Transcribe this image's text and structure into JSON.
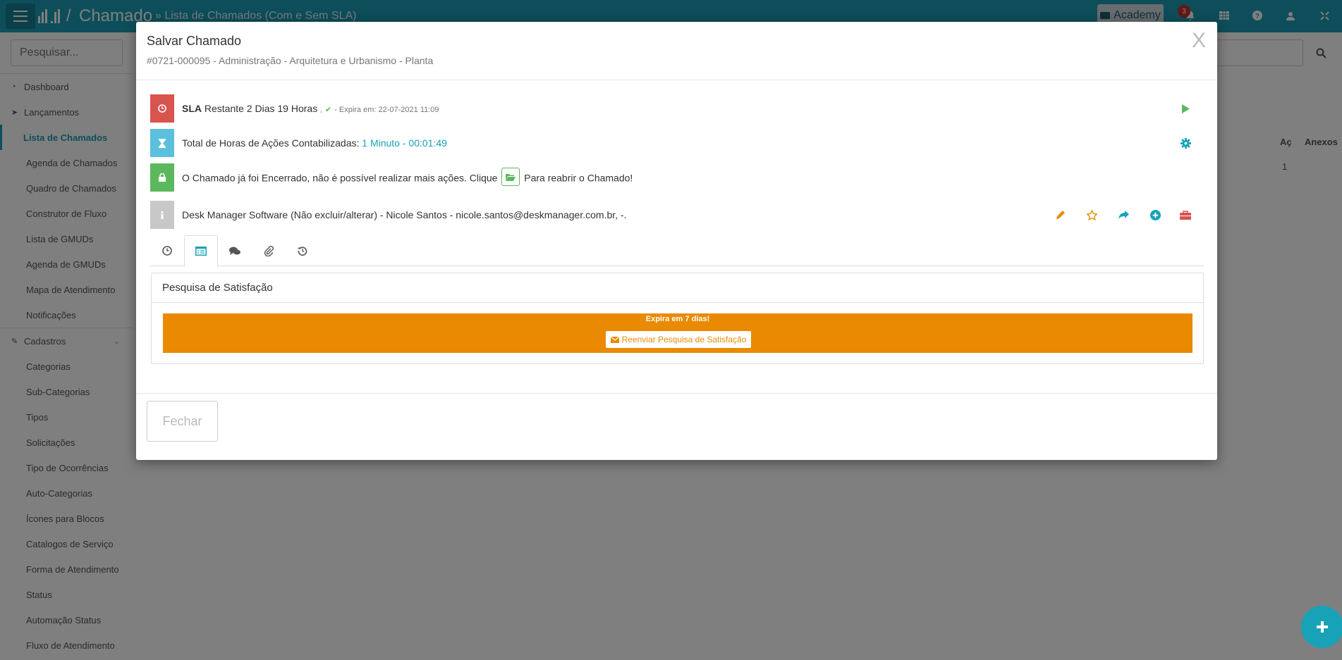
{
  "topbar": {
    "app_title": "Chamado",
    "breadcrumb": "» Lista de Chamados (Com e Sem SLA)",
    "academy_label": "Academy",
    "notification_count": "3"
  },
  "sidebar": {
    "search_placeholder": "Pesquisar...",
    "items": [
      {
        "label": "Dashboard",
        "icon": "dashboard-icon"
      },
      {
        "label": "Lançamentos",
        "icon": "paper-plane-icon"
      },
      {
        "label": "Lista de Chamados",
        "active": true
      },
      {
        "label": "Agenda de Chamados"
      },
      {
        "label": "Quadro de Chamados"
      },
      {
        "label": "Construtor de Fluxo"
      },
      {
        "label": "Lista de GMUDs"
      },
      {
        "label": "Agenda de GMUDs"
      },
      {
        "label": "Mapa de Atendimento"
      },
      {
        "label": "Notificações"
      },
      {
        "label": "Cadastros",
        "icon": "edit-icon"
      },
      {
        "label": "Categorias"
      },
      {
        "label": "Sub-Categorias"
      },
      {
        "label": "Tipos"
      },
      {
        "label": "Solicitações"
      },
      {
        "label": "Tipo de Ocorrências"
      },
      {
        "label": "Auto-Categorias"
      },
      {
        "label": "Ícones para Blocos"
      },
      {
        "label": "Catalogos de Serviço"
      },
      {
        "label": "Forma de Atendimento"
      },
      {
        "label": "Status"
      },
      {
        "label": "Automação Status"
      },
      {
        "label": "Fluxo de Atendimento"
      }
    ]
  },
  "main": {
    "columns": [
      "Aç",
      "Anexos"
    ],
    "row_value": "1"
  },
  "modal": {
    "title": "Salvar Chamado",
    "subtitle": "#0721-000095 - Administração - Arquitetura e Urbanismo - Planta",
    "close_symbol": "X",
    "sla": {
      "label": "SLA",
      "remaining": "Restante 2 Dias 19 Horas",
      "comma": ",",
      "expires": "- Expira em: 22-07-2021 11:09"
    },
    "hours": {
      "label": "Total de Horas de Ações Contabilizadas:",
      "value": "1 Minuto - 00:01:49"
    },
    "closed": {
      "before": "O Chamado já foi Encerrado, não é possível realizar mais ações. Clique",
      "after": "Para reabrir o Chamado!"
    },
    "requester": "Desk Manager Software (Não excluir/alterar) - Nicole Santos - nicole.santos@deskmanager.com.br, -.",
    "survey": {
      "heading": "Pesquisa de Satisfação",
      "expires": "Expira em 7 dias!",
      "resend_label": "Reenviar Pesquisa de Satisfação"
    },
    "footer": {
      "close_label": "Fechar"
    }
  },
  "colors": {
    "brand": "#1a9cb4",
    "sla_red": "#d9534f",
    "info_blue": "#5bc0de",
    "success_green": "#5cb85c",
    "neutral_grey": "#c8c8c8",
    "warning_orange": "#e98a02",
    "action_blue": "#17a2b8"
  }
}
